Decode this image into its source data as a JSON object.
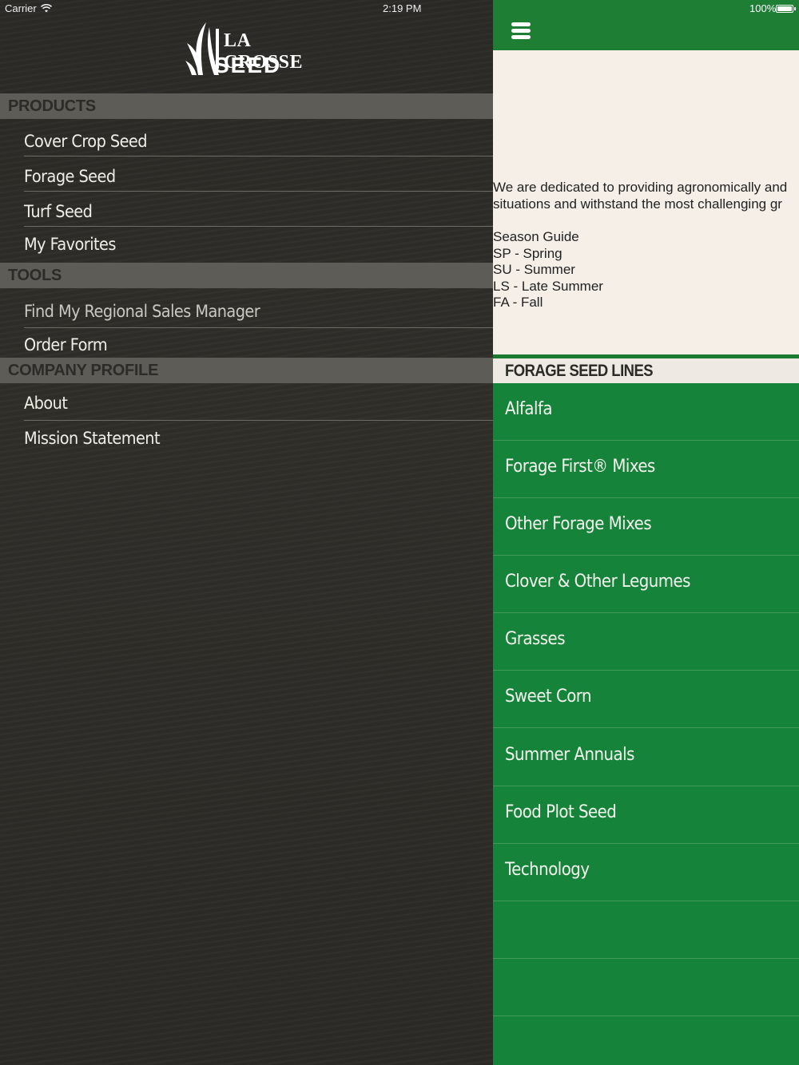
{
  "status_bar": {
    "carrier": "Carrier",
    "time": "2:19 PM",
    "battery": "100%"
  },
  "logo": {
    "line1": "LA CROSSE",
    "line2": "SEED"
  },
  "drawer": {
    "products_header": "PRODUCTS",
    "products": [
      "Cover Crop Seed",
      "Forage Seed",
      "Turf Seed",
      "My Favorites"
    ],
    "tools_header": "TOOLS",
    "tools": [
      "Find My Regional Sales Manager",
      "Order Form"
    ],
    "company_header": "COMPANY PROFILE",
    "company": [
      "About",
      "Mission Statement"
    ]
  },
  "content": {
    "intro_line1": "We are dedicated to providing agronomically and",
    "intro_line2": "situations and withstand the most challenging gr",
    "season_guide": [
      "Season Guide",
      "SP - Spring",
      "SU - Summer",
      "LS - Late Summer",
      "FA - Fall"
    ],
    "lines_header": "FORAGE SEED LINES",
    "lines": [
      "Alfalfa",
      "Forage First® Mixes",
      "Other Forage Mixes",
      "Clover & Other Legumes",
      "Grasses",
      "Sweet Corn",
      "Summer Annuals",
      "Food Plot Seed",
      "Technology"
    ]
  },
  "colors": {
    "drawer_bg": "#2b2a26",
    "section_header_bg": "#5d5c57",
    "green": "#15843a",
    "cream": "#f5efe8"
  },
  "icons": [
    "wifi-icon",
    "hamburger-menu-icon",
    "battery-icon",
    "logo-wheat-icon"
  ]
}
